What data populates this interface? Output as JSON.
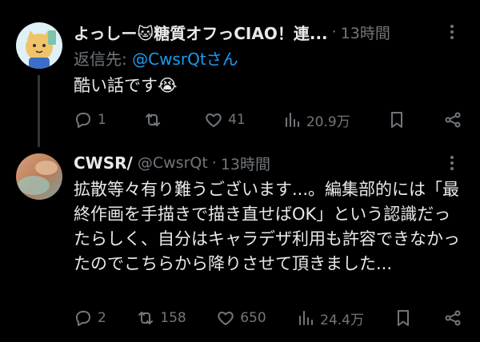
{
  "tweets": [
    {
      "name": "よっしー🐱糖質オフっCIAO！連...",
      "dot": "·",
      "time": "13時間",
      "reply_label": "返信先: ",
      "reply_mention": "@CwsrQtさん",
      "text": "酷い話です😭",
      "replies": "1",
      "retweets": "",
      "likes": "41",
      "views": "20.9万"
    },
    {
      "name": "CWSR/",
      "handle": "@CwsrQt",
      "dot": "·",
      "time": "13時間",
      "text": "拡散等々有り難うございます...。編集部的には「最終作画を手描きで描き直せばOK」という認識だったらしく、自分はキャラデザ利用も許容できなかったのでこちらから降りさせて頂きました...",
      "replies": "2",
      "retweets": "158",
      "likes": "650",
      "views": "24.4万"
    }
  ],
  "icons": [
    "more-icon",
    "reply-icon",
    "retweet-icon",
    "like-icon",
    "views-icon",
    "bookmark-icon",
    "share-icon"
  ],
  "colors": {
    "background": "#000000",
    "text": "#e7e9ea",
    "muted": "#71767b",
    "link": "#1d9bf0",
    "thread_line": "#333639"
  }
}
